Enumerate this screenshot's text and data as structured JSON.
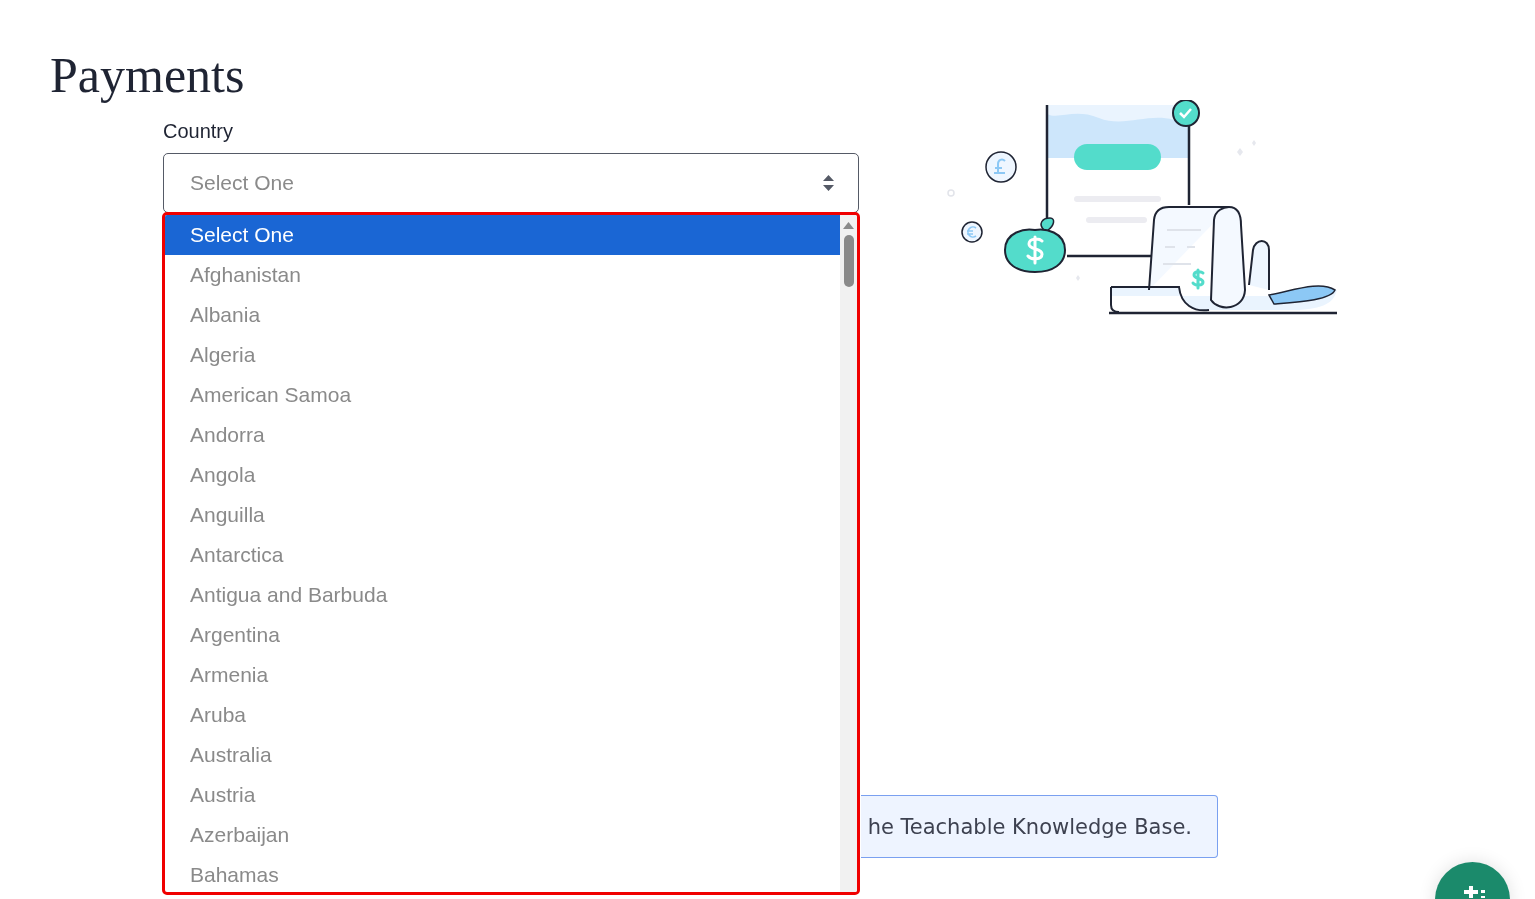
{
  "page_title": "Payments",
  "country_field": {
    "label": "Country",
    "value": "Select One",
    "expanded": true,
    "options": [
      {
        "label": "Select One",
        "selected": true
      },
      {
        "label": "Afghanistan",
        "selected": false
      },
      {
        "label": "Albania",
        "selected": false
      },
      {
        "label": "Algeria",
        "selected": false
      },
      {
        "label": "American Samoa",
        "selected": false
      },
      {
        "label": "Andorra",
        "selected": false
      },
      {
        "label": "Angola",
        "selected": false
      },
      {
        "label": "Anguilla",
        "selected": false
      },
      {
        "label": "Antarctica",
        "selected": false
      },
      {
        "label": "Antigua and Barbuda",
        "selected": false
      },
      {
        "label": "Argentina",
        "selected": false
      },
      {
        "label": "Armenia",
        "selected": false
      },
      {
        "label": "Aruba",
        "selected": false
      },
      {
        "label": "Australia",
        "selected": false
      },
      {
        "label": "Austria",
        "selected": false
      },
      {
        "label": "Azerbaijan",
        "selected": false
      },
      {
        "label": "Bahamas",
        "selected": false
      }
    ]
  },
  "info_notice": {
    "text": "he Teachable Knowledge Base."
  }
}
